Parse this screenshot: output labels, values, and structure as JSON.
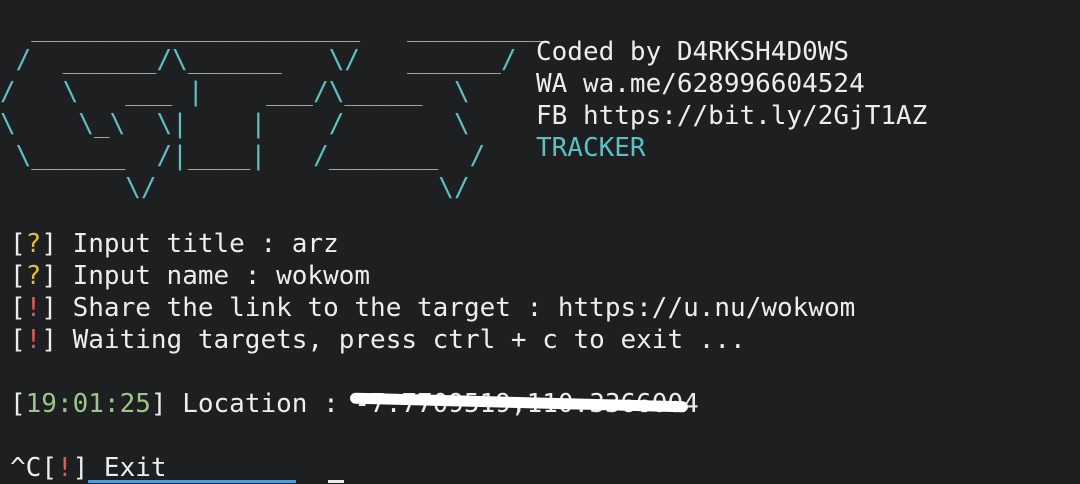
{
  "banner": {
    "art": "  _____________________   _________\n /  ______/\\______   \\/   ______/\n/   \\   ___ |    ___/\\_____  \\\n\\    \\_\\  \\|    |    /       \\\n \\______  /|____|   /_______  /\n        \\/                  \\/"
  },
  "credits": {
    "coded_by": "Coded by D4RKSH4D0WS",
    "wa": "WA wa.me/628996604524",
    "fb": "FB https://bit.ly/2GjT1AZ",
    "tracker": "TRACKER"
  },
  "prompts": {
    "open": "[",
    "close": "]",
    "question": "?",
    "bang": "!",
    "title_text": " Input title : arz",
    "name_text": " Input name : wokwom",
    "share_text": " Share the link to the target : https://u.nu/wokwom",
    "waiting_text": " Waiting targets, press ctrl + c to exit ..."
  },
  "location": {
    "time": "19:01:25",
    "label": " Location : ",
    "value": "-7.7709519,110.3366004"
  },
  "exit": {
    "prefix": "^C",
    "text": " Exit"
  }
}
